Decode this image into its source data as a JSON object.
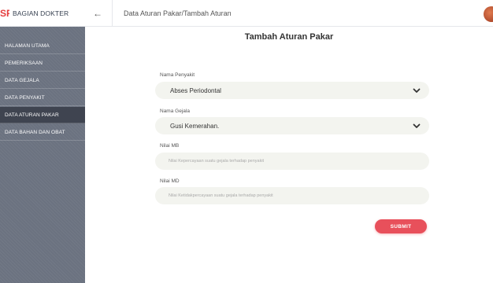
{
  "sidebar": {
    "logo": "SP",
    "brand": "BAGIAN DOKTER",
    "items": [
      {
        "label": "HALAMAN UTAMA"
      },
      {
        "label": "PEMERIKSAAN"
      },
      {
        "label": "DATA GEJALA"
      },
      {
        "label": "DATA PENYAKIT"
      },
      {
        "label": "DATA ATURAN PAKAR",
        "active": true
      },
      {
        "label": "DATA BAHAN DAN OBAT"
      }
    ]
  },
  "topbar": {
    "back_icon": "arrow-left-icon",
    "breadcrumb": "Data Aturan Pakar/Tambah Aturan",
    "avatar_icon": "user-avatar"
  },
  "form": {
    "title": "Tambah Aturan Pakar",
    "penyakit": {
      "label": "Nama Penyakit",
      "value": "Abses Periodontal"
    },
    "gejala": {
      "label": "Nama Gejala",
      "value": "Gusi Kemerahan."
    },
    "mb": {
      "label": "Nilai MB",
      "placeholder": "Nilai Kepercayaan suatu gejala terhadap penyakit",
      "value": ""
    },
    "md": {
      "label": "Nilai MD",
      "placeholder": "Nilai Ketidakpercayaan suatu gejala terhadap penyakit",
      "value": ""
    },
    "submit_label": "SUBMIT"
  },
  "colors": {
    "accent": "#e8505b",
    "sidebar_bg": "#6b7280",
    "sidebar_active": "#3f4450",
    "field_bg": "#f3f4ef"
  }
}
